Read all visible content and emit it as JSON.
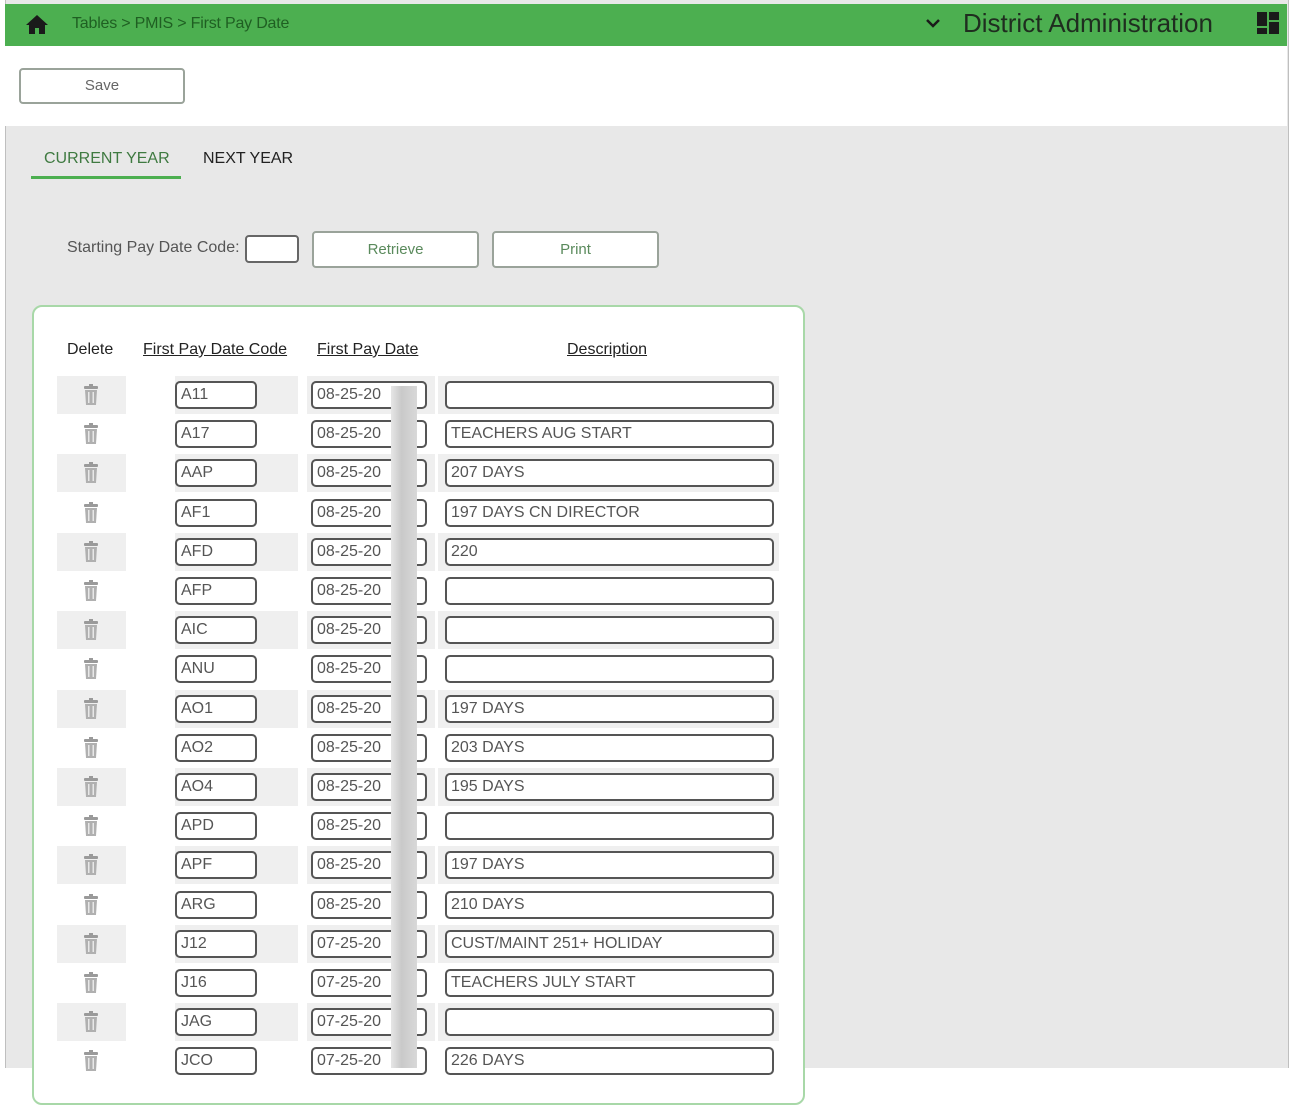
{
  "header": {
    "breadcrumb": "Tables > PMIS > First Pay Date",
    "district": "District Administration"
  },
  "toolbar": {
    "save_label": "Save"
  },
  "tabs": {
    "current": "CURRENT YEAR",
    "next": "NEXT YEAR"
  },
  "filter": {
    "label": "Starting Pay Date Code:",
    "value": "",
    "retrieve_label": "Retrieve",
    "print_label": "Print"
  },
  "table": {
    "headers": {
      "delete": "Delete",
      "code": "First Pay Date Code",
      "date": "First Pay Date",
      "description": "Description"
    },
    "rows": [
      {
        "code": "A11",
        "date": "08-25-20",
        "description": ""
      },
      {
        "code": "A17",
        "date": "08-25-20",
        "description": "TEACHERS AUG START"
      },
      {
        "code": "AAP",
        "date": "08-25-20",
        "description": "207  DAYS"
      },
      {
        "code": "AF1",
        "date": "08-25-20",
        "description": "197 DAYS CN DIRECTOR"
      },
      {
        "code": "AFD",
        "date": "08-25-20",
        "description": "220"
      },
      {
        "code": "AFP",
        "date": "08-25-20",
        "description": ""
      },
      {
        "code": "AIC",
        "date": "08-25-20",
        "description": ""
      },
      {
        "code": "ANU",
        "date": "08-25-20",
        "description": ""
      },
      {
        "code": "AO1",
        "date": "08-25-20",
        "description": "197 DAYS"
      },
      {
        "code": "AO2",
        "date": "08-25-20",
        "description": "203 DAYS"
      },
      {
        "code": "AO4",
        "date": "08-25-20",
        "description": "195 DAYS"
      },
      {
        "code": "APD",
        "date": "08-25-20",
        "description": ""
      },
      {
        "code": "APF",
        "date": "08-25-20",
        "description": "197 DAYS"
      },
      {
        "code": "ARG",
        "date": "08-25-20",
        "description": "210 DAYS"
      },
      {
        "code": "J12",
        "date": "07-25-20",
        "description": "CUST/MAINT 251+ HOLIDAY"
      },
      {
        "code": "J16",
        "date": "07-25-20",
        "description": "TEACHERS JULY START"
      },
      {
        "code": "JAG",
        "date": "07-25-20",
        "description": ""
      },
      {
        "code": "JCO",
        "date": "07-25-20",
        "description": "226 DAYS"
      }
    ]
  },
  "colors": {
    "accent": "#4caf50",
    "panel_border": "#a8d8a8"
  },
  "icons": {
    "home": "home-icon",
    "chevron": "chevron-down-icon",
    "apps": "grid-icon",
    "delete": "trash-icon"
  }
}
